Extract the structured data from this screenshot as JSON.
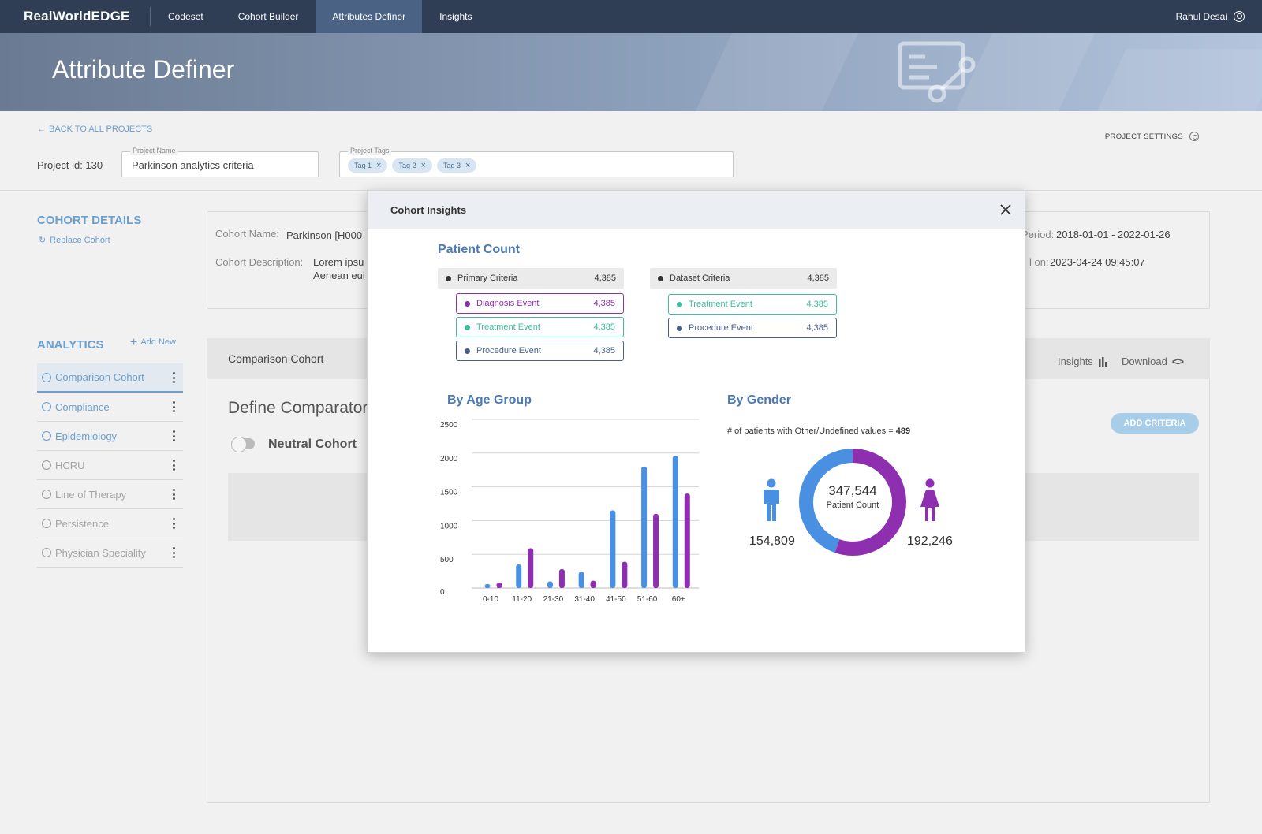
{
  "topnav": {
    "brand": "RealWorldEDGE",
    "items": [
      {
        "label": "Codeset"
      },
      {
        "label": "Cohort Builder"
      },
      {
        "label": "Attributes Definer"
      },
      {
        "label": "Insights"
      }
    ],
    "active_index": 2,
    "user": "Rahul Desai"
  },
  "banner": {
    "title": "Attribute Definer"
  },
  "project": {
    "back_link": "BACK TO ALL PROJECTS",
    "settings_label": "PROJECT SETTINGS",
    "id_label": "Project id: 130",
    "name_legend": "Project Name",
    "name_value": "Parkinson analytics criteria",
    "tags_legend": "Project Tags",
    "tags": [
      "Tag 1",
      "Tag 2",
      "Tag 3"
    ]
  },
  "cohort_details": {
    "title": "COHORT DETAILS",
    "replace": "Replace Cohort",
    "name_label": "Cohort Name:",
    "name_value": "Parkinson  [H000",
    "desc_label": "Cohort Description:",
    "desc_line1": "Lorem ipsu",
    "desc_line2": "Aenean eui",
    "period_label": "Period:",
    "period_value": "2018-01-01 - 2022-01-26",
    "created_label": "l on:",
    "created_value": "2023-04-24 09:45:07"
  },
  "analytics": {
    "title": "ANALYTICS",
    "add_new": "Add New",
    "items": [
      {
        "label": "Comparison Cohort"
      },
      {
        "label": "Compliance"
      },
      {
        "label": "Epidemiology"
      },
      {
        "label": "HCRU"
      },
      {
        "label": "Line of Therapy"
      },
      {
        "label": "Persistence"
      },
      {
        "label": "Physician Speciality"
      }
    ]
  },
  "comparison": {
    "header": "Comparison Cohort",
    "insights": "Insights",
    "download": "Download",
    "define_title": "Define Comparator C",
    "toggle_label": "Neutral Cohort",
    "add_criteria": "ADD CRITERIA"
  },
  "modal": {
    "title": "Cohort Insights",
    "patient_count_title": "Patient Count",
    "primary": {
      "label": "Primary Criteria",
      "count": "4,385",
      "items": [
        {
          "label": "Diagnosis Event",
          "count": "4,385"
        },
        {
          "label": "Treatment Event",
          "count": "4,385"
        },
        {
          "label": "Procedure Event",
          "count": "4,385"
        }
      ]
    },
    "dataset": {
      "label": "Dataset Criteria",
      "count": "4,385",
      "items": [
        {
          "label": "Treatment Event",
          "count": "4,385"
        },
        {
          "label": "Procedure Event",
          "count": "4,385"
        }
      ]
    },
    "age_title": "By Age Group",
    "gender_title": "By Gender",
    "other_note_text": "# of patients with Other/Undefined values = ",
    "other_note_value": "489",
    "male_count": "154,809",
    "female_count": "192,246",
    "total_count": "347,544",
    "total_label": "Patient Count"
  },
  "colors": {
    "blue": "#4a90e2",
    "purple": "#8e2fb0",
    "teal": "#3bbf9e",
    "navy": "#4a5f8c",
    "accent": "#6a9fd0"
  },
  "chart_data": [
    {
      "type": "bar",
      "title": "By Age Group",
      "categories": [
        "0-10",
        "11-20",
        "21-30",
        "31-40",
        "41-50",
        "51-60",
        "60+"
      ],
      "series": [
        {
          "values": [
            60,
            350,
            100,
            240,
            1150,
            1800,
            1960
          ]
        },
        {
          "values": [
            80,
            590,
            280,
            110,
            390,
            1100,
            1400
          ]
        }
      ],
      "ylim": [
        0,
        2500
      ],
      "yticks": [
        0,
        500,
        1000,
        1500,
        2000,
        2500
      ],
      "grid": true
    },
    {
      "type": "pie",
      "title": "By Gender",
      "labels": [
        "Male",
        "Female"
      ],
      "values": [
        154809,
        192246
      ]
    }
  ]
}
